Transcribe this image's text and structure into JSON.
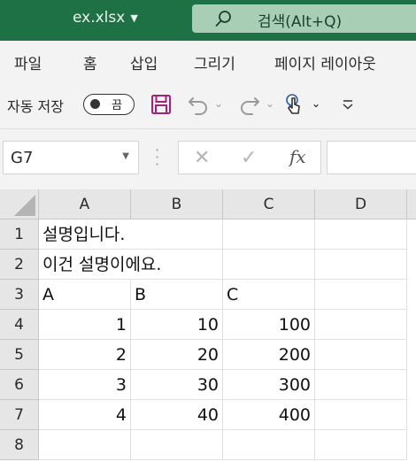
{
  "title_bar": {
    "filename": "ex.xlsx",
    "search_placeholder": "검색(Alt+Q)",
    "background": "#1e7145"
  },
  "menu_tabs": [
    "파일",
    "홈",
    "삽입",
    "그리기",
    "페이지 레이아웃"
  ],
  "toolbar": {
    "autosave_label": "자동 저장",
    "autosave_state": "끔",
    "icons": [
      "save-icon",
      "undo-icon",
      "redo-icon",
      "touch-mode-icon",
      "customize-toolbar-icon"
    ]
  },
  "formula_bar": {
    "name_box": "G7",
    "fx_label": "fx",
    "formula": ""
  },
  "sheet": {
    "columns": [
      "A",
      "B",
      "C",
      "D"
    ],
    "rows": [
      "1",
      "2",
      "3",
      "4",
      "5",
      "6",
      "7",
      "8"
    ],
    "cells": {
      "r1": {
        "A": "설명입니다.",
        "B": "",
        "C": "",
        "D": ""
      },
      "r2": {
        "A": "이건 설명이에요.",
        "B": "",
        "C": "",
        "D": ""
      },
      "r3": {
        "A": "A",
        "B": "B",
        "C": "C",
        "D": ""
      },
      "r4": {
        "A": "1",
        "B": "10",
        "C": "100",
        "D": ""
      },
      "r5": {
        "A": "2",
        "B": "20",
        "C": "200",
        "D": ""
      },
      "r6": {
        "A": "3",
        "B": "30",
        "C": "300",
        "D": ""
      },
      "r7": {
        "A": "4",
        "B": "40",
        "C": "400",
        "D": ""
      },
      "r8": {
        "A": "",
        "B": "",
        "C": "",
        "D": ""
      }
    }
  }
}
